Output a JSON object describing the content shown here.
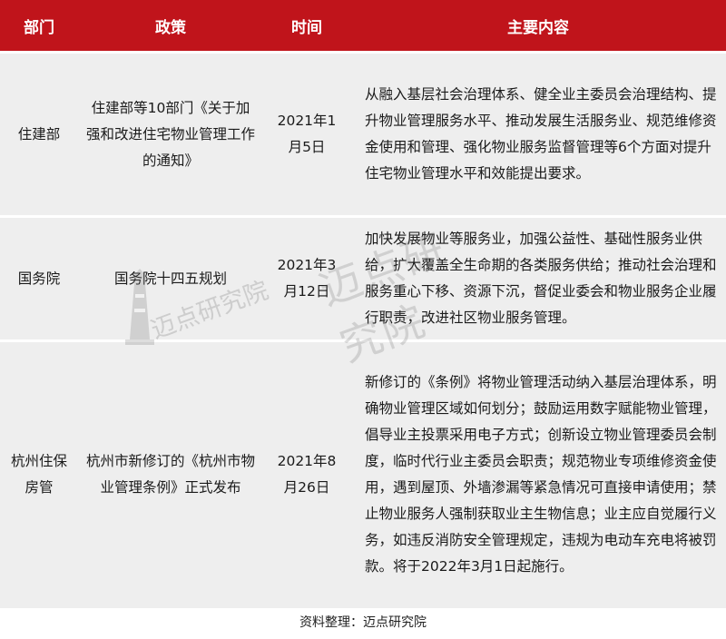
{
  "header": {
    "col1": "部门",
    "col2": "政策",
    "col3": "时间",
    "col4": "主要内容"
  },
  "rows": [
    {
      "dept": "住建部",
      "policy": "住建部等10部门《关于加强和改进住宅物业管理工作的通知》",
      "date": "2021年1月5日",
      "content": "从融入基层社会治理体系、健全业主委员会治理结构、提升物业管理服务水平、推动发展生活服务业、规范维修资金使用和管理、强化物业服务监督管理等6个方面对提升住宅物业管理水平和效能提出要求。"
    },
    {
      "dept": "国务院",
      "policy": "国务院十四五规划",
      "date": "2021年3月12日",
      "content": "加快发展物业等服务业，加强公益性、基础性服务业供给，扩大覆盖全生命期的各类服务供给；推动社会治理和服务重心下移、资源下沉，督促业委会和物业服务企业履行职责，改进社区物业服务管理。"
    },
    {
      "dept": "杭州住保房管",
      "policy": "杭州市新修订的《杭州市物业管理条例》正式发布",
      "date": "2021年8月26日",
      "content": "新修订的《条例》将物业管理活动纳入基层治理体系，明确物业管理区域如何划分；鼓励运用数字赋能物业管理，倡导业主投票采用电子方式；创新设立物业管理委员会制度，临时代行业主委员会职责；规范物业专项维修资金使用，遇到屋顶、外墙渗漏等紧急情况可直接申请使用；禁止物业服务人强制获取业主生物信息；业主应自觉履行义务，如违反消防安全管理规定，违规为电动车充电将被罚款。将于2022年3月1日起施行。"
    }
  ],
  "watermark": {
    "logo_text": "迈点研究院",
    "big_text": "迈点研究院"
  },
  "footer": {
    "source": "资料整理：迈点研究院"
  },
  "colors": {
    "header_bg": "#c0141b",
    "row_bg": "#eeeeee"
  }
}
